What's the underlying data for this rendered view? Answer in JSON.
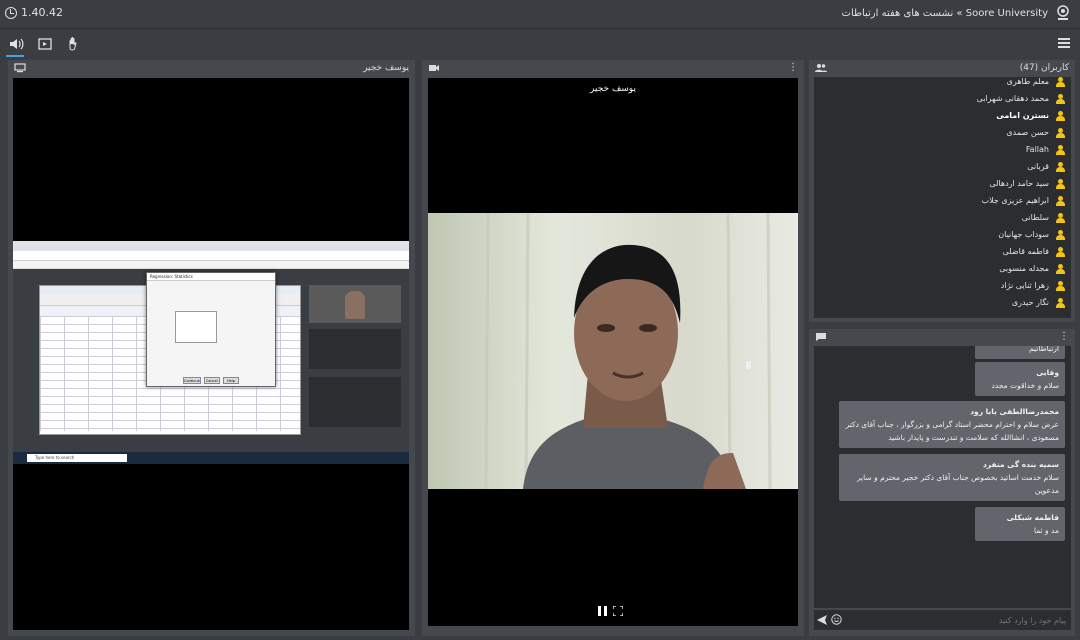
{
  "topbar": {
    "timer": "1.40.42",
    "title": "Soore University » نشست های هفته ارتباطات"
  },
  "toolbar": {
    "audio_icon": "speaker-icon",
    "screen_icon": "screen-share-icon",
    "hand_icon": "raise-hand-icon",
    "menu_icon": "hamburger-icon"
  },
  "screen_panel": {
    "title": "یوسف خجیر",
    "icon": "monitor-icon",
    "shared_content": {
      "taskbar_search": "Type here to search",
      "dialog_title": "Regression: Statistics",
      "buttons": [
        "Continue",
        "Cancel",
        "Help"
      ]
    }
  },
  "video_panel": {
    "caption": "یوسف خجیر",
    "icon": "camera-icon",
    "controls": [
      "pause-icon",
      "fullscreen-icon"
    ]
  },
  "users_panel": {
    "title": "کاربران (47)",
    "icon": "users-icon",
    "users": [
      {
        "name": "معلم طاهری",
        "bold": false
      },
      {
        "name": "محمد دهقانی شهرابی",
        "bold": false
      },
      {
        "name": "نسترن امامی",
        "bold": true
      },
      {
        "name": "حسن صمدی",
        "bold": false
      },
      {
        "name": "Fallah",
        "bold": false
      },
      {
        "name": "قربانی",
        "bold": false
      },
      {
        "name": "سید حامد اردهالی",
        "bold": false
      },
      {
        "name": "ابراهیم عزیزی جلاب",
        "bold": false
      },
      {
        "name": "سلطانی",
        "bold": false
      },
      {
        "name": "سوداب جهانیان",
        "bold": false
      },
      {
        "name": "فاطمه قاضلی",
        "bold": false
      },
      {
        "name": "مجدله منسوبی",
        "bold": false
      },
      {
        "name": "زهرا ثنایی نژاد",
        "bold": false
      },
      {
        "name": "نگار حیدری",
        "bold": false
      }
    ]
  },
  "chat_panel": {
    "icon": "chat-icon",
    "messages": [
      {
        "name": "",
        "text": "ارتباطاتیم"
      },
      {
        "name": "وفایی",
        "text": "سلام و خداقوت مجدد"
      },
      {
        "name": "محمدرضاالطفی بابا رود",
        "text": "عرض سلام و احترام محضر استاد گرامی و بزرگوار ، جناب آقای دکتر مسعودی ، انشاالله که سلامت و تندرست و پایدار باشید"
      },
      {
        "name": "سمیه بنده گی منفرد",
        "text": "سلام خدمت اساتید بخصوص جناب آقای دکتر خجیر محترم و سایر مدعوین"
      },
      {
        "name": "فاطمه شبکلی",
        "text": "مد و ثما"
      }
    ],
    "input_placeholder": "پیام خود را وارد کنید",
    "send_icon": "send-icon",
    "emoji_icon": "emoji-icon"
  }
}
